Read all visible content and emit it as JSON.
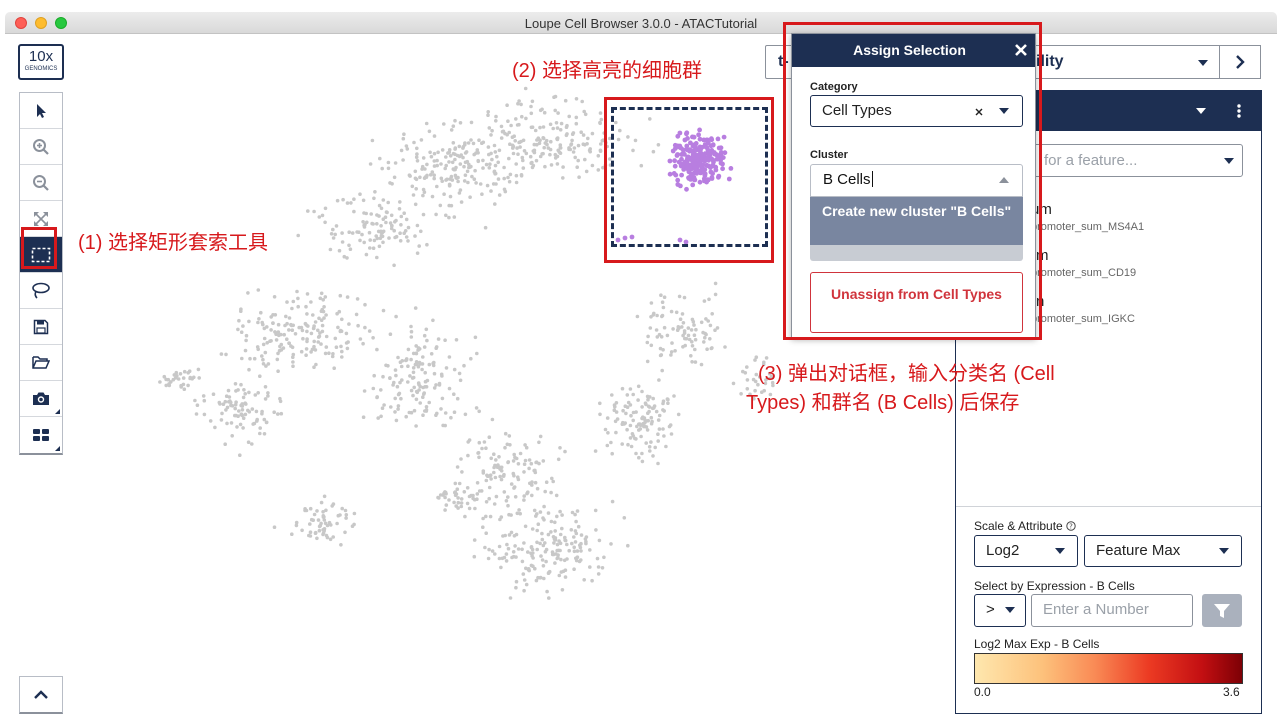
{
  "window": {
    "title": "Loupe Cell Browser 3.0.0 - ATACTutorial"
  },
  "logo": {
    "line1": "10x",
    "line2": "GENOMICS"
  },
  "toolbar": {
    "tools": [
      {
        "icon": "pointer-icon"
      },
      {
        "icon": "zoom-in-icon"
      },
      {
        "icon": "zoom-out-icon"
      },
      {
        "icon": "fit-screen-icon"
      },
      {
        "icon": "rectangle-select-icon",
        "active": true
      },
      {
        "icon": "lasso-icon"
      },
      {
        "icon": "save-icon"
      },
      {
        "icon": "folder-open-icon"
      },
      {
        "icon": "camera-icon"
      },
      {
        "icon": "layout-grid-icon"
      }
    ],
    "collapse_icon": "chevron-up-icon"
  },
  "projection": {
    "prefix": "t-",
    "suffix": "ility"
  },
  "feature_panel": {
    "search_placeholder": "for a feature...",
    "features": [
      {
        "name": "um",
        "sub": "promoter_sum_MS4A1"
      },
      {
        "name": "m",
        "sub": "promoter_sum_CD19"
      },
      {
        "name": "n",
        "sub": "promoter_sum_IGKC"
      }
    ],
    "scale_label": "Scale & Attribute",
    "scale_value": "Log2",
    "attribute_value": "Feature Max",
    "select_by_label": "Select by Expression - B Cells",
    "operator_value": ">",
    "number_placeholder": "Enter a Number",
    "colorbar_label": "Log2 Max Exp - B Cells",
    "colorbar_min": "0.0",
    "colorbar_max": "3.6"
  },
  "dialog": {
    "title": "Assign Selection",
    "category_label": "Category",
    "category_value": "Cell Types",
    "cluster_label": "Cluster",
    "cluster_value": "B Cells",
    "create_option": "Create new cluster \"B Cells\"",
    "unassign_label": "Unassign from Cell Types"
  },
  "annotations": {
    "step1": "(1) 选择矩形套索工具",
    "step2": "(2) 选择高亮的细胞群",
    "step3_line1": "(3) 弹出对话框，输入分类名 (Cell",
    "step3_line2": "Types) 和群名 (B Cells) 后保存"
  },
  "colors": {
    "navy": "#1d2f52",
    "highlight_cells": "#b87ee0",
    "background_cells": "#c8c8c8",
    "annotation_red": "#d7191c"
  }
}
